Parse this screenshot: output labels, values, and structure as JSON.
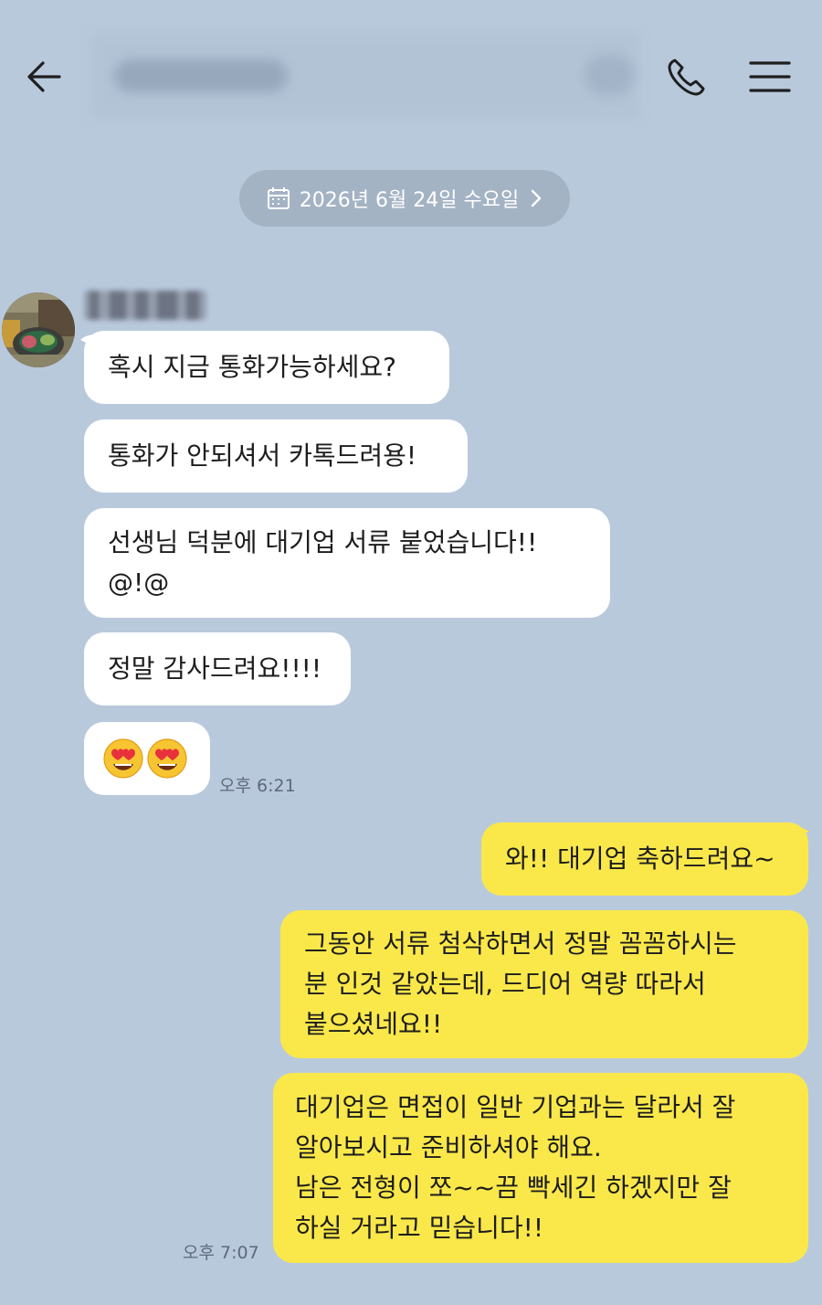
{
  "header": {
    "back_icon": "back-arrow-icon",
    "title": "",
    "call_icon": "phone-icon",
    "menu_icon": "hamburger-menu-icon"
  },
  "date_divider": {
    "label": "2026년 6월 24일 수요일",
    "icon": "calendar-icon"
  },
  "sender": {
    "name": "",
    "avatar": "profile-photo"
  },
  "incoming_messages": [
    {
      "text": "혹시 지금 통화가능하세요?"
    },
    {
      "text": "통화가 안되셔서 카톡드려용!"
    },
    {
      "text": "선생님 덕분에 대기업 서류 붙었습니다!!\n@!@"
    },
    {
      "text": "정말 감사드려요!!!!"
    },
    {
      "emoji": "heart-eyes-emoji x2"
    }
  ],
  "incoming_time": "오후 6:21",
  "outgoing_messages": [
    {
      "text": "와!! 대기업 축하드려요~"
    },
    {
      "text": "그동안 서류 첨삭하면서 정말 꼼꼼하시는\n분 인것 같았는데, 드디어 역량 따라서\n붙으셨네요!!"
    },
    {
      "text": "대기업은 면접이 일반 기업과는 달라서 잘\n알아보시고 준비하셔야 해요.\n남은 전형이 쪼~~끔 빡세긴 하겠지만 잘\n하실 거라고 믿습니다!!"
    }
  ],
  "outgoing_time": "오후 7:07",
  "colors": {
    "background": "#b9c9dc",
    "incoming_bubble": "#ffffff",
    "outgoing_bubble": "#fae84a",
    "date_chip": "#a4b3c4"
  }
}
